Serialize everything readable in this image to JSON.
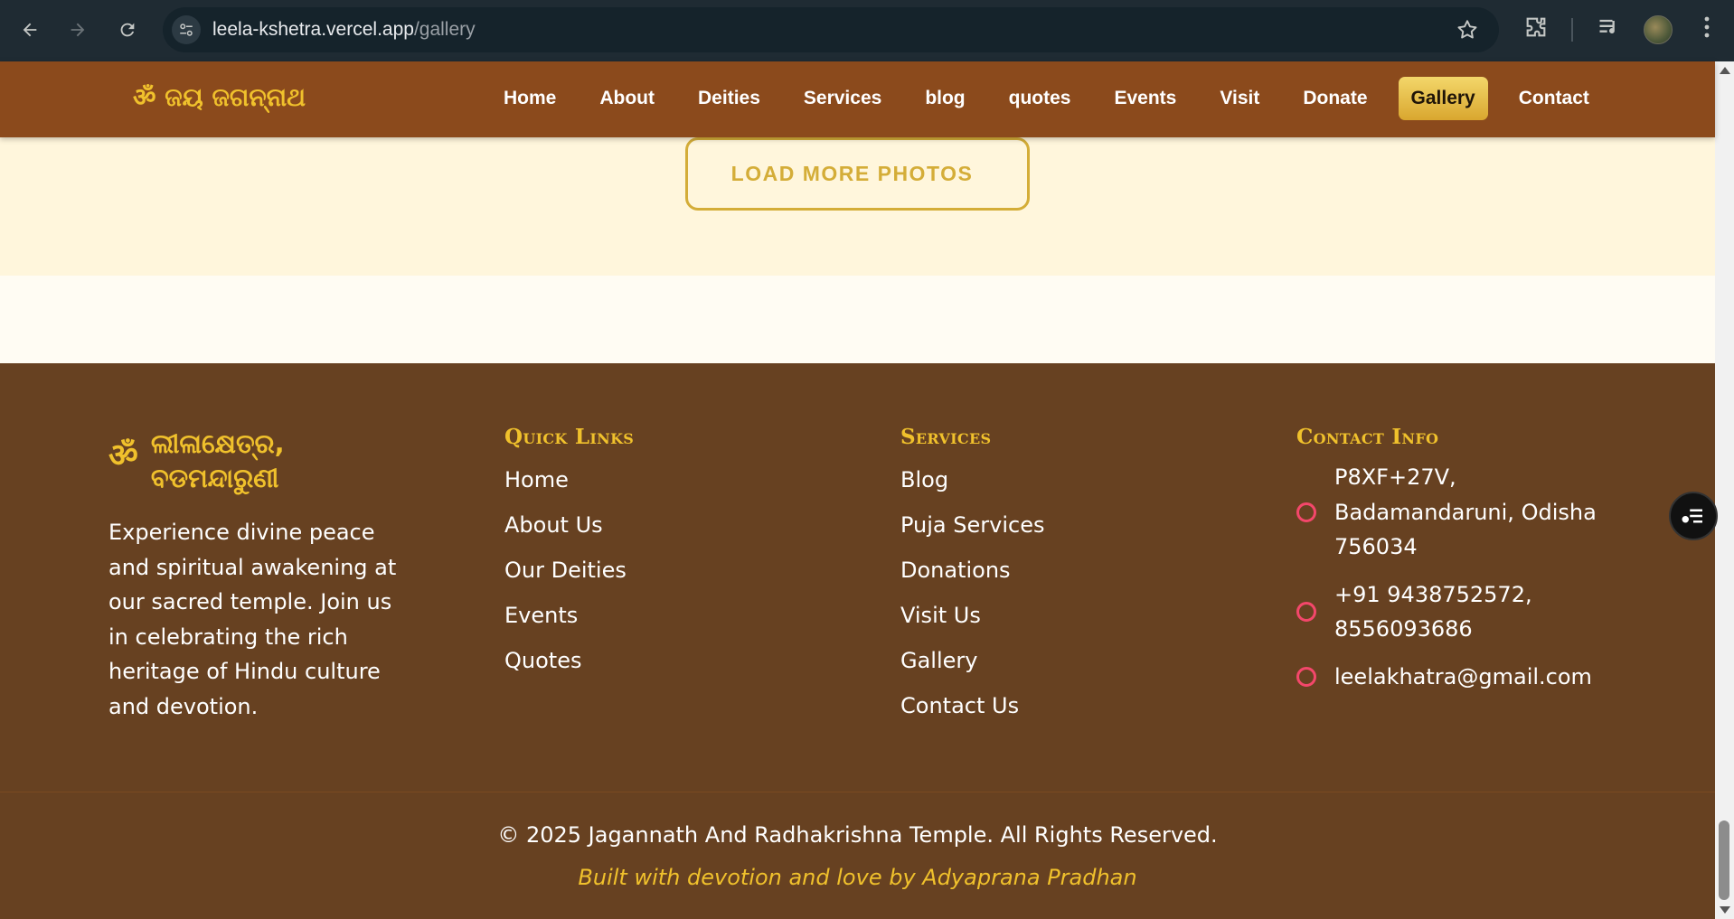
{
  "browser": {
    "url_host": "leela-kshetra.vercel.app",
    "url_path": "/gallery",
    "back_icon": "arrow-left-icon",
    "forward_icon": "arrow-right-icon",
    "reload_icon": "reload-icon",
    "bookmark_icon": "star-icon",
    "extensions_icon": "puzzle-icon",
    "media_icon": "media-control-icon",
    "menu_icon": "kebab-menu-icon"
  },
  "header": {
    "logo": "ॐ ଜୟ ଜଗନ୍ନାଥ",
    "nav": [
      {
        "label": "Home",
        "active": false
      },
      {
        "label": "About",
        "active": false
      },
      {
        "label": "Deities",
        "active": false
      },
      {
        "label": "Services",
        "active": false
      },
      {
        "label": "blog",
        "active": false
      },
      {
        "label": "quotes",
        "active": false
      },
      {
        "label": "Events",
        "active": false
      },
      {
        "label": "Visit",
        "active": false
      },
      {
        "label": "Donate",
        "active": false
      },
      {
        "label": "Gallery",
        "active": true
      },
      {
        "label": "Contact",
        "active": false
      }
    ]
  },
  "gallery": {
    "load_more_label": "LOAD MORE PHOTOS"
  },
  "footer": {
    "om": "ॐ",
    "brand_name": "ଲୀଳାକ୍ଷେତ୍ର, ବଡମନ୍ଦାରୁଣୀ",
    "description": "Experience divine peace and spiritual awakening at our sacred temple. Join us in celebrating the rich heritage of Hindu culture and devotion.",
    "quick_links": {
      "heading": "Quick Links",
      "items": [
        "Home",
        "About Us",
        "Our Deities",
        "Events",
        "Quotes"
      ]
    },
    "services": {
      "heading": "Services",
      "items": [
        "Blog",
        "Puja Services",
        "Donations",
        "Visit Us",
        "Gallery",
        "Contact Us"
      ]
    },
    "contact": {
      "heading": "Contact Info",
      "address": "P8XF+27V, Badamandaruni, Odisha 756034",
      "phone": "+91 9438752572, 8556093686",
      "email": "leelakhatra@gmail.com"
    },
    "copyright": "© 2025 Jagannath And Radhakrishna Temple. All Rights Reserved.",
    "credit": "Built with devotion and love by Adyaprana Pradhan"
  },
  "colors": {
    "header_bg": "#8b4a1c",
    "footer_bg": "#674121",
    "gold": "#f0c12c",
    "contact_icon": "#f4476b"
  }
}
